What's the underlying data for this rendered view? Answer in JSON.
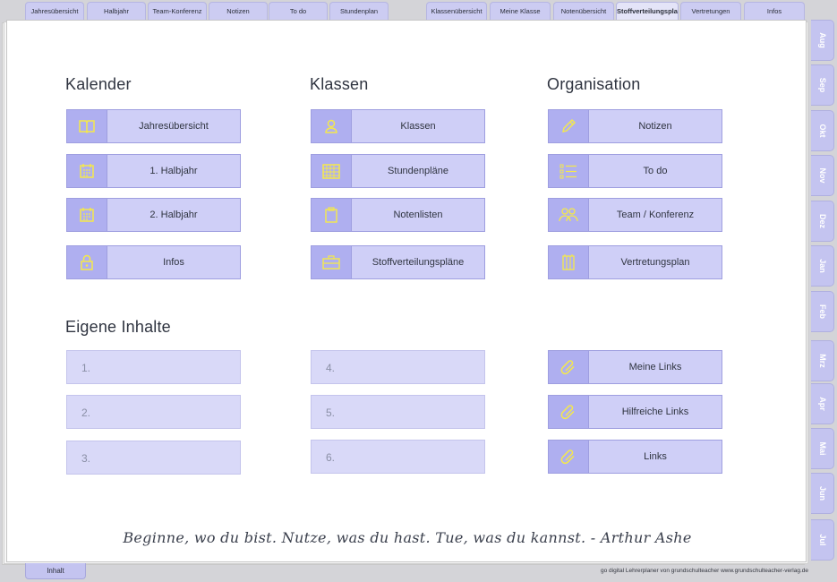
{
  "top_tabs": [
    {
      "label": "Jahresübersicht",
      "active": false
    },
    {
      "label": "Halbjahr",
      "active": false
    },
    {
      "label": "Team-Konferenz",
      "active": false
    },
    {
      "label": "Notizen",
      "active": false
    },
    {
      "label": "To do",
      "active": false
    },
    {
      "label": "Stundenplan",
      "active": false
    },
    {
      "label": "Klassenübersicht",
      "active": false
    },
    {
      "label": "Meine Klasse",
      "active": false
    },
    {
      "label": "Notenübersicht",
      "active": false
    },
    {
      "label": "Stoffverteilungsplan",
      "active": true
    },
    {
      "label": "Vertretungen",
      "active": false
    },
    {
      "label": "Infos",
      "active": false
    }
  ],
  "month_tabs": [
    "Aug",
    "Sep",
    "Okt",
    "Nov",
    "Dez",
    "Jan",
    "Feb",
    "Mrz",
    "Apr",
    "Mai",
    "Jun",
    "Jul"
  ],
  "sections": {
    "kalender": {
      "title": "Kalender",
      "buttons": [
        {
          "label": "Jahresübersicht",
          "icon": "book-icon"
        },
        {
          "label": "1. Halbjahr",
          "icon": "calendar-icon"
        },
        {
          "label": "2. Halbjahr",
          "icon": "calendar-icon"
        },
        {
          "label": "Infos",
          "icon": "lock-icon"
        }
      ]
    },
    "klassen": {
      "title": "Klassen",
      "buttons": [
        {
          "label": "Klassen",
          "icon": "person-icon"
        },
        {
          "label": "Stundenpläne",
          "icon": "grid-icon"
        },
        {
          "label": "Notenlisten",
          "icon": "clipboard-icon"
        },
        {
          "label": "Stoffverteilungspläne",
          "icon": "briefcase-icon"
        }
      ]
    },
    "organisation": {
      "title": "Organisation",
      "buttons": [
        {
          "label": "Notizen",
          "icon": "pencil-icon"
        },
        {
          "label": "To do",
          "icon": "checklist-icon"
        },
        {
          "label": "Team / Konferenz",
          "icon": "team-icon"
        },
        {
          "label": "Vertretungsplan",
          "icon": "columns-icon"
        }
      ]
    },
    "eigene": {
      "title": "Eigene Inhalte",
      "fields": [
        "1.",
        "2.",
        "3.",
        "4.",
        "5.",
        "6."
      ],
      "links": [
        {
          "label": "Meine Links",
          "icon": "paperclip-icon"
        },
        {
          "label": "Hilfreiche Links",
          "icon": "paperclip-icon"
        },
        {
          "label": "Links",
          "icon": "paperclip-icon"
        }
      ]
    }
  },
  "quote": "Beginne, wo du bist. Nutze, was du hast. Tue, was du kannst. - Arthur Ashe",
  "bottom_tab": "Inhalt",
  "footer": "go digital Lehrerplaner von grundschulteacher www.grundschulteacher-verlag.de",
  "colors": {
    "accent": "#afaff0",
    "button": "#cfcff7",
    "icon_yellow": "#f5e94a"
  }
}
